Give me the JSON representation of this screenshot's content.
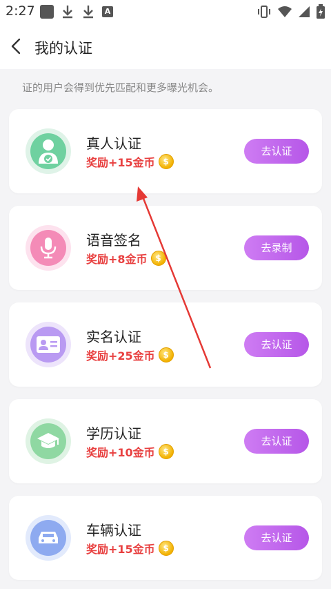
{
  "status_bar": {
    "time": "2:27",
    "a_icon_letter": "A"
  },
  "header": {
    "title": "我的认证"
  },
  "hint": "证的用户会得到优先匹配和更多曝光机会。",
  "colors": {
    "button_start": "#ce7cf3",
    "button_end": "#b657e8",
    "reward": "#e84040",
    "arrow": "#e53935"
  },
  "cards": [
    {
      "title": "真人认证",
      "reward": "奖励+15金币",
      "button": "去认证",
      "icon": "person-verified-icon"
    },
    {
      "title": "语音签名",
      "reward": "奖励+8金币",
      "button": "去录制",
      "icon": "microphone-icon"
    },
    {
      "title": "实名认证",
      "reward": "奖励+25金币",
      "button": "去认证",
      "icon": "id-card-icon"
    },
    {
      "title": "学历认证",
      "reward": "奖励+10金币",
      "button": "去认证",
      "icon": "graduation-cap-icon"
    },
    {
      "title": "车辆认证",
      "reward": "奖励+15金币",
      "button": "去认证",
      "icon": "car-icon"
    }
  ],
  "coin_symbol": "$"
}
